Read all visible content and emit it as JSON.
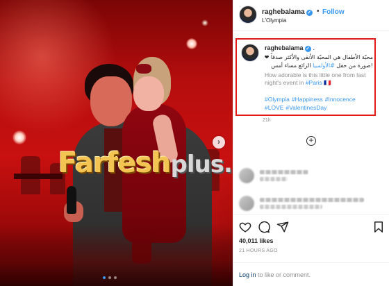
{
  "header": {
    "username": "raghebalama",
    "verified_mark": "✓",
    "separator": "•",
    "follow_label": "Follow",
    "location": "L'Olympia"
  },
  "photo": {
    "watermark_main": "Farfesh",
    "watermark_plus": "plus.com",
    "next_icon": "›",
    "page_dots": 3,
    "active_dot": 1
  },
  "caption": {
    "username": "raghebalama",
    "verified_mark": "✓",
    "trailing_dots": ".",
    "arabic_line1": "محبّة الأطفال هي المحبّة الأنقى والأكثر صدقاً ❤",
    "arabic_line2_pre": "!صورة من حفل ",
    "arabic_tag": "#الأولمبيا",
    "arabic_line2_post": " الرائع مساء أمس",
    "english_text": "How adorable is this little one from last night's event in ",
    "english_tag": "#Paris",
    "english_suffix": " 🇫🇷",
    "hashtags": [
      "#Olympia",
      "#Happiness",
      "#Innocence",
      "#LOVE",
      "#ValentinesDay"
    ],
    "time": "21h"
  },
  "comments": {
    "load_more_icon": "+"
  },
  "actions": {
    "like_icon": "heart-icon",
    "comment_icon": "comment-icon",
    "share_icon": "share-icon",
    "save_icon": "bookmark-icon"
  },
  "stats": {
    "likes": "40,011 likes",
    "posted": "21 HOURS AGO"
  },
  "login": {
    "link": "Log in",
    "rest": " to like or comment."
  },
  "colors": {
    "accent": "#3897f0",
    "highlight_border": "#e21a1a",
    "muted": "#8e8e8e"
  }
}
